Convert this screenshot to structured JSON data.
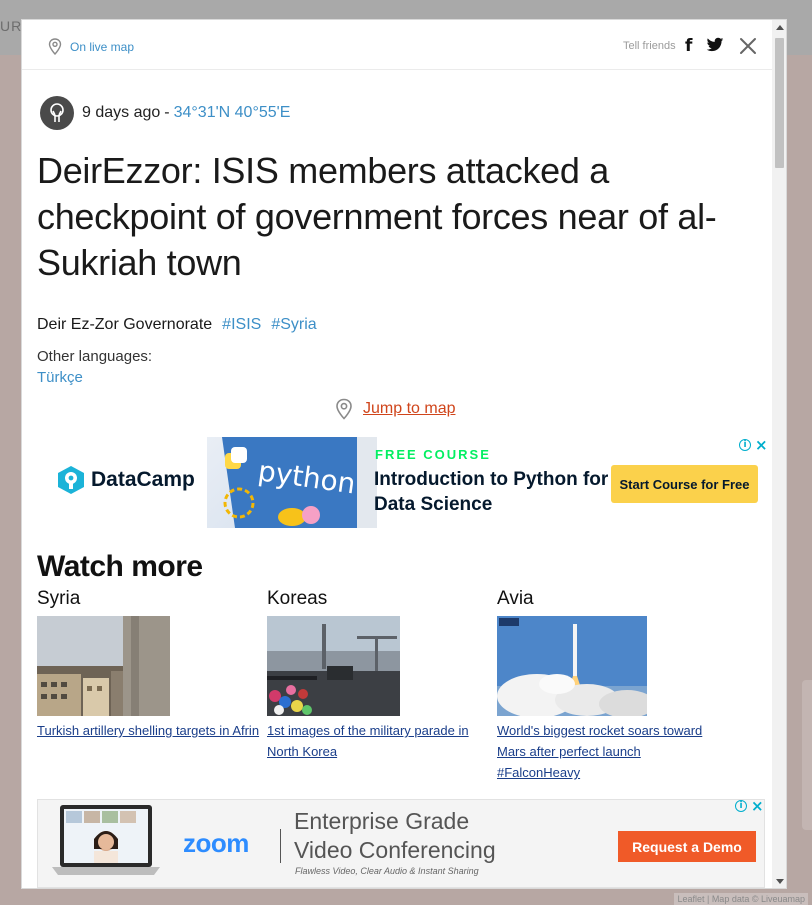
{
  "background": {
    "top_text": "URC",
    "attribution": "Leaflet | Map data © Liveuamap"
  },
  "header": {
    "live_map_label": "On live map",
    "tell_friends": "Tell friends",
    "share_icons": [
      "facebook-icon",
      "twitter-icon"
    ],
    "close_icon": "close-icon"
  },
  "article": {
    "time_ago": "9 days ago",
    "separator": "-",
    "coordinates": "34°31'N 40°55'E",
    "headline": "DeirEzzor: ISIS members attacked a checkpoint of government forces near of al-Sukriah town",
    "location": "Deir Ez-Zor Governorate",
    "tags": [
      "#ISIS",
      "#Syria"
    ],
    "other_languages_label": "Other languages:",
    "languages": [
      "Türkçe"
    ],
    "jump_to_map": "Jump to map"
  },
  "ad1": {
    "brand": "DataCamp",
    "image_text": "python",
    "free_course": "FREE COURSE",
    "title": "Introduction to Python for Data Science",
    "button": "Start Course for Free"
  },
  "watch_more": {
    "heading": "Watch more",
    "columns": [
      {
        "title": "Syria",
        "caption": "Turkish artillery shelling targets in Afrin"
      },
      {
        "title": "Koreas",
        "caption": "1st images of the military parade in North Korea"
      },
      {
        "title": "Avia",
        "caption": "World's biggest rocket soars toward Mars after perfect launch #FalconHeavy"
      }
    ]
  },
  "ad2": {
    "brand": "zoom",
    "headline_line1": "Enterprise Grade",
    "headline_line2": "Video Conferencing",
    "sub": "Flawless Video, Clear Audio & Instant Sharing",
    "button": "Request a Demo"
  },
  "colors": {
    "link_blue": "#3d8fc7",
    "jump_link": "#d0451b",
    "datacamp_yellow": "#fbd14b",
    "zoom_blue": "#2d8cff",
    "zoom_orange": "#f05a28"
  }
}
